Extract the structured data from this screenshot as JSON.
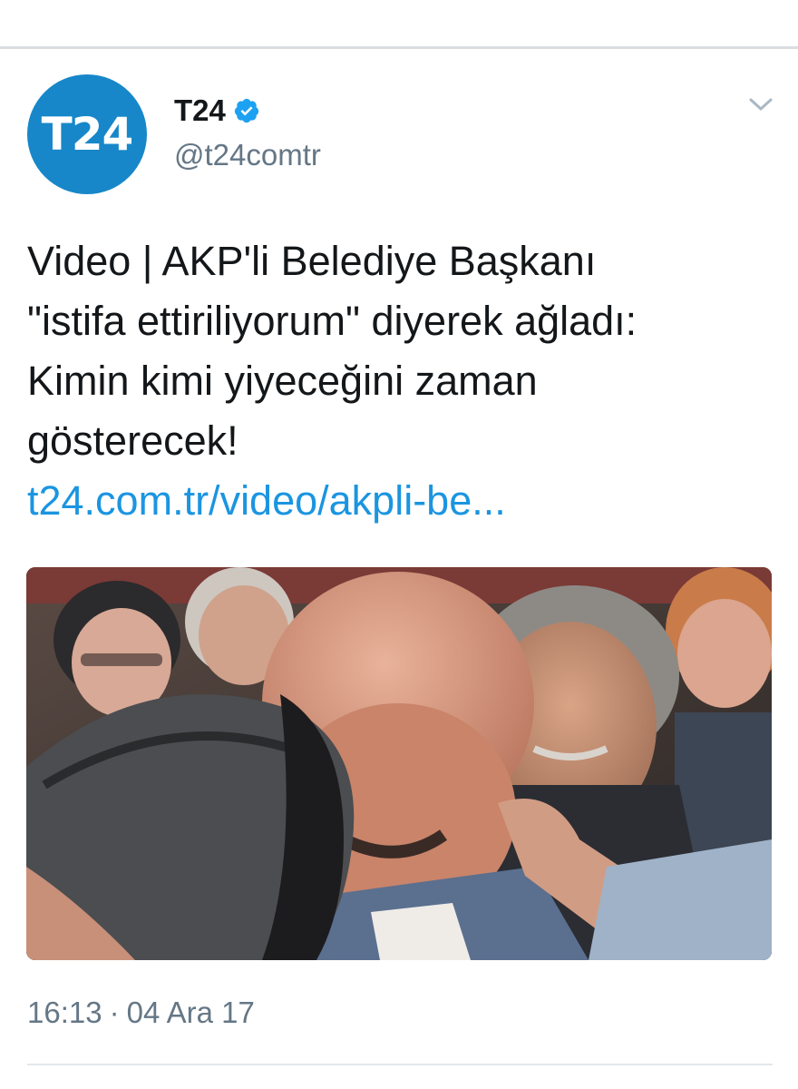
{
  "tweet": {
    "author": {
      "avatar_text": "T24",
      "display_name": "T24",
      "handle": "@t24comtr",
      "verified": true
    },
    "text_lines": [
      "Video | AKP'li Belediye Başkanı",
      "\"istifa ettiriliyorum\" diyerek ağladı:",
      "Kimin kimi yiyeceğini zaman",
      "gösterecek!"
    ],
    "link": "t24.com.tr/video/akpli-be...",
    "time": "16:13",
    "date": "04 Ara 17"
  },
  "colors": {
    "brand_blue": "#1787c9",
    "link_blue": "#1b95e0",
    "text": "#14171a",
    "secondary": "#657786",
    "verified": "#1da1f2"
  },
  "icons": {
    "verified": "verified-badge-icon",
    "menu": "chevron-down-icon"
  }
}
